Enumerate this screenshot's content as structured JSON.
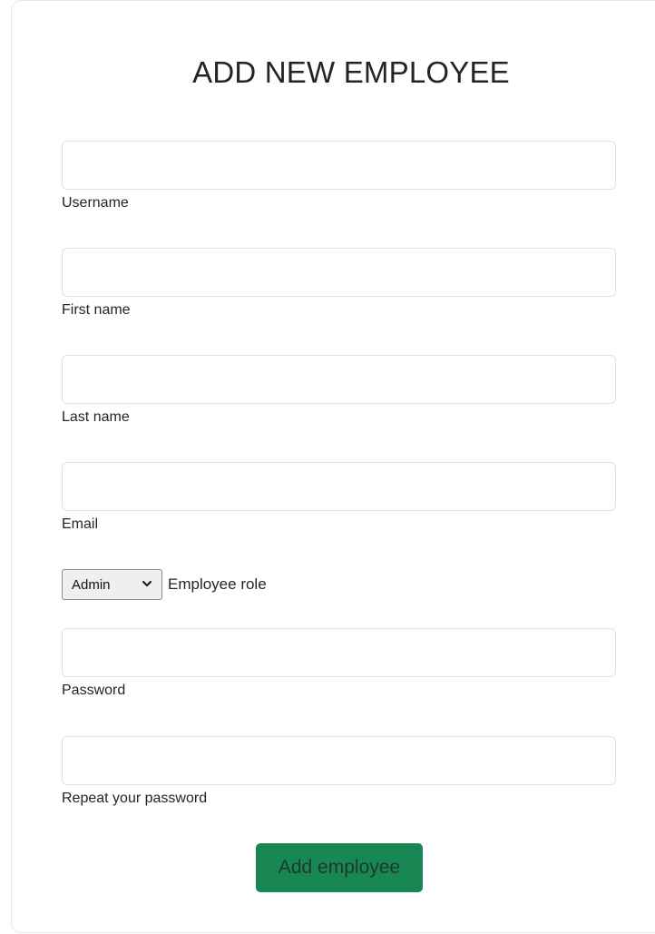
{
  "form": {
    "title": "ADD NEW EMPLOYEE",
    "fields": {
      "username": {
        "label": "Username",
        "value": ""
      },
      "first_name": {
        "label": "First name",
        "value": ""
      },
      "last_name": {
        "label": "Last name",
        "value": ""
      },
      "email": {
        "label": "Email",
        "value": ""
      },
      "password": {
        "label": "Password",
        "value": ""
      },
      "repeat_password": {
        "label": "Repeat your password",
        "value": ""
      }
    },
    "role": {
      "selected": "Admin",
      "label": "Employee role",
      "icon": "chevron-down-icon"
    },
    "submit_label": "Add employee"
  },
  "colors": {
    "submit_button": "#198754",
    "input_border": "#dee2e6"
  }
}
